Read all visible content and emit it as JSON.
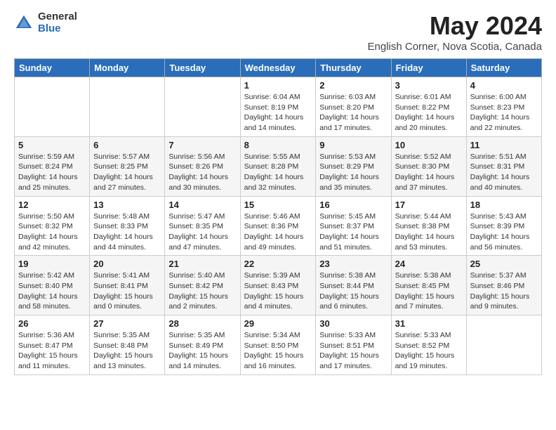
{
  "logo": {
    "general": "General",
    "blue": "Blue"
  },
  "title": {
    "month": "May 2024",
    "location": "English Corner, Nova Scotia, Canada"
  },
  "weekdays": [
    "Sunday",
    "Monday",
    "Tuesday",
    "Wednesday",
    "Thursday",
    "Friday",
    "Saturday"
  ],
  "weeks": [
    [
      {
        "day": "",
        "info": ""
      },
      {
        "day": "",
        "info": ""
      },
      {
        "day": "",
        "info": ""
      },
      {
        "day": "1",
        "info": "Sunrise: 6:04 AM\nSunset: 8:19 PM\nDaylight: 14 hours\nand 14 minutes."
      },
      {
        "day": "2",
        "info": "Sunrise: 6:03 AM\nSunset: 8:20 PM\nDaylight: 14 hours\nand 17 minutes."
      },
      {
        "day": "3",
        "info": "Sunrise: 6:01 AM\nSunset: 8:22 PM\nDaylight: 14 hours\nand 20 minutes."
      },
      {
        "day": "4",
        "info": "Sunrise: 6:00 AM\nSunset: 8:23 PM\nDaylight: 14 hours\nand 22 minutes."
      }
    ],
    [
      {
        "day": "5",
        "info": "Sunrise: 5:59 AM\nSunset: 8:24 PM\nDaylight: 14 hours\nand 25 minutes."
      },
      {
        "day": "6",
        "info": "Sunrise: 5:57 AM\nSunset: 8:25 PM\nDaylight: 14 hours\nand 27 minutes."
      },
      {
        "day": "7",
        "info": "Sunrise: 5:56 AM\nSunset: 8:26 PM\nDaylight: 14 hours\nand 30 minutes."
      },
      {
        "day": "8",
        "info": "Sunrise: 5:55 AM\nSunset: 8:28 PM\nDaylight: 14 hours\nand 32 minutes."
      },
      {
        "day": "9",
        "info": "Sunrise: 5:53 AM\nSunset: 8:29 PM\nDaylight: 14 hours\nand 35 minutes."
      },
      {
        "day": "10",
        "info": "Sunrise: 5:52 AM\nSunset: 8:30 PM\nDaylight: 14 hours\nand 37 minutes."
      },
      {
        "day": "11",
        "info": "Sunrise: 5:51 AM\nSunset: 8:31 PM\nDaylight: 14 hours\nand 40 minutes."
      }
    ],
    [
      {
        "day": "12",
        "info": "Sunrise: 5:50 AM\nSunset: 8:32 PM\nDaylight: 14 hours\nand 42 minutes."
      },
      {
        "day": "13",
        "info": "Sunrise: 5:48 AM\nSunset: 8:33 PM\nDaylight: 14 hours\nand 44 minutes."
      },
      {
        "day": "14",
        "info": "Sunrise: 5:47 AM\nSunset: 8:35 PM\nDaylight: 14 hours\nand 47 minutes."
      },
      {
        "day": "15",
        "info": "Sunrise: 5:46 AM\nSunset: 8:36 PM\nDaylight: 14 hours\nand 49 minutes."
      },
      {
        "day": "16",
        "info": "Sunrise: 5:45 AM\nSunset: 8:37 PM\nDaylight: 14 hours\nand 51 minutes."
      },
      {
        "day": "17",
        "info": "Sunrise: 5:44 AM\nSunset: 8:38 PM\nDaylight: 14 hours\nand 53 minutes."
      },
      {
        "day": "18",
        "info": "Sunrise: 5:43 AM\nSunset: 8:39 PM\nDaylight: 14 hours\nand 56 minutes."
      }
    ],
    [
      {
        "day": "19",
        "info": "Sunrise: 5:42 AM\nSunset: 8:40 PM\nDaylight: 14 hours\nand 58 minutes."
      },
      {
        "day": "20",
        "info": "Sunrise: 5:41 AM\nSunset: 8:41 PM\nDaylight: 15 hours\nand 0 minutes."
      },
      {
        "day": "21",
        "info": "Sunrise: 5:40 AM\nSunset: 8:42 PM\nDaylight: 15 hours\nand 2 minutes."
      },
      {
        "day": "22",
        "info": "Sunrise: 5:39 AM\nSunset: 8:43 PM\nDaylight: 15 hours\nand 4 minutes."
      },
      {
        "day": "23",
        "info": "Sunrise: 5:38 AM\nSunset: 8:44 PM\nDaylight: 15 hours\nand 6 minutes."
      },
      {
        "day": "24",
        "info": "Sunrise: 5:38 AM\nSunset: 8:45 PM\nDaylight: 15 hours\nand 7 minutes."
      },
      {
        "day": "25",
        "info": "Sunrise: 5:37 AM\nSunset: 8:46 PM\nDaylight: 15 hours\nand 9 minutes."
      }
    ],
    [
      {
        "day": "26",
        "info": "Sunrise: 5:36 AM\nSunset: 8:47 PM\nDaylight: 15 hours\nand 11 minutes."
      },
      {
        "day": "27",
        "info": "Sunrise: 5:35 AM\nSunset: 8:48 PM\nDaylight: 15 hours\nand 13 minutes."
      },
      {
        "day": "28",
        "info": "Sunrise: 5:35 AM\nSunset: 8:49 PM\nDaylight: 15 hours\nand 14 minutes."
      },
      {
        "day": "29",
        "info": "Sunrise: 5:34 AM\nSunset: 8:50 PM\nDaylight: 15 hours\nand 16 minutes."
      },
      {
        "day": "30",
        "info": "Sunrise: 5:33 AM\nSunset: 8:51 PM\nDaylight: 15 hours\nand 17 minutes."
      },
      {
        "day": "31",
        "info": "Sunrise: 5:33 AM\nSunset: 8:52 PM\nDaylight: 15 hours\nand 19 minutes."
      },
      {
        "day": "",
        "info": ""
      }
    ]
  ]
}
